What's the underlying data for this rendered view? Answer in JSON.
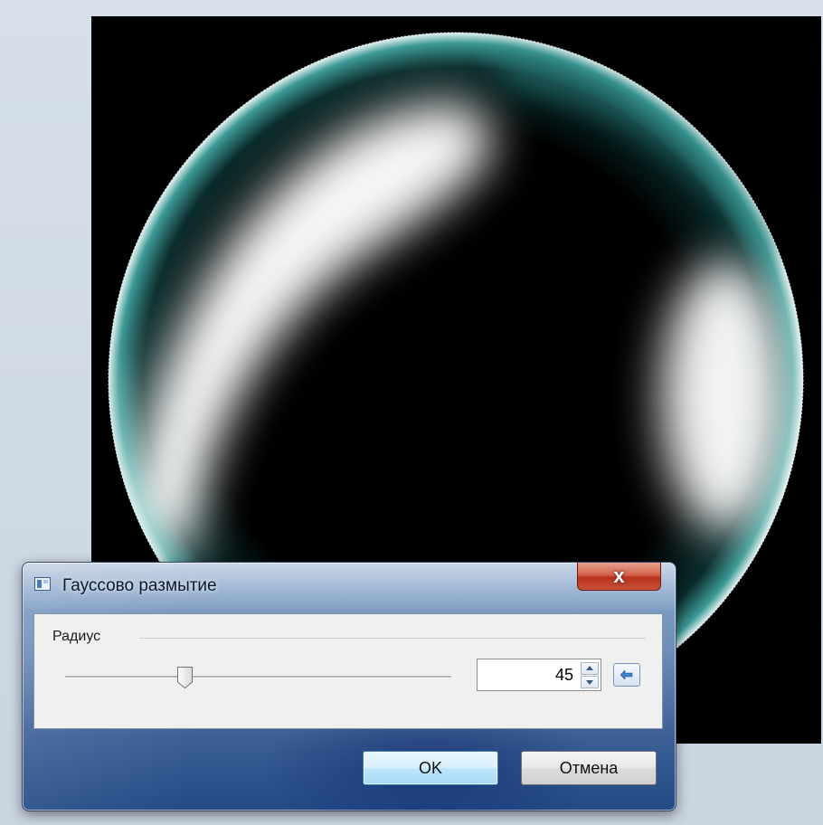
{
  "dialog": {
    "title": "Гауссово размытие",
    "close_symbol": "x",
    "radius_label": "Радиус",
    "radius_value": "45",
    "slider_fraction": 0.31,
    "ok_label": "OK",
    "cancel_label": "Отмена"
  },
  "icons": {
    "title_icon": "window-app-icon",
    "reset": "arrow-left-icon",
    "spin_up": "chevron-up-icon",
    "spin_down": "chevron-down-icon"
  },
  "colors": {
    "canvas_bg": "#000000",
    "sphere_teal": "#2f8c8a",
    "highlight": "#ffffff",
    "dialog_frame": "#234a86",
    "close_red": "#c8523a"
  }
}
